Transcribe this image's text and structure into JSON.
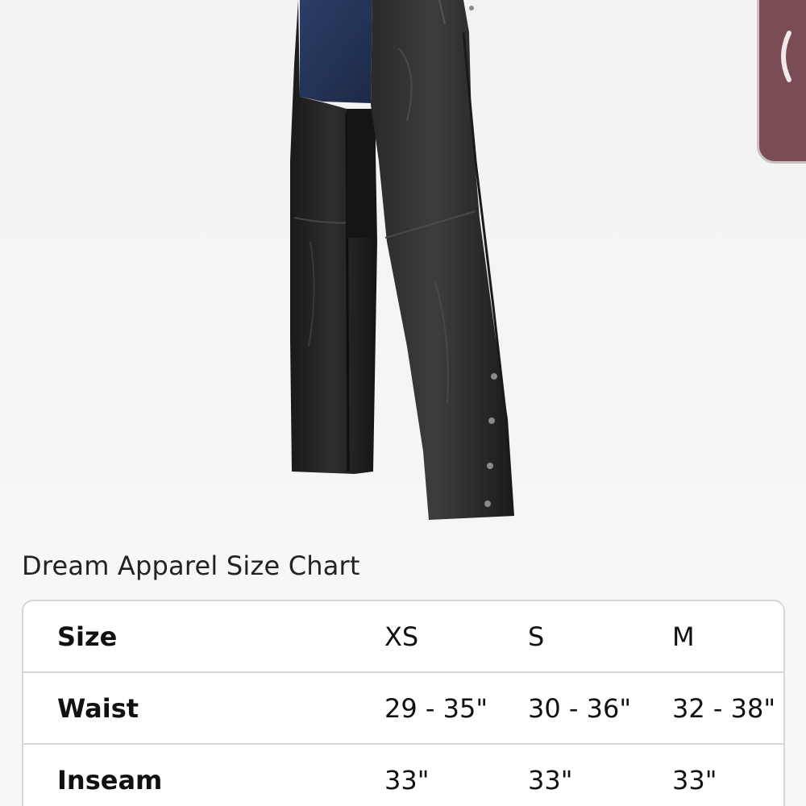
{
  "side_tab": {
    "icon": "chevron-left-icon",
    "color": "#7a4d55"
  },
  "product": {
    "image": "black-leather-chaps-photo"
  },
  "size_chart": {
    "title": "Dream Apparel Size Chart",
    "rows": [
      {
        "label": "Size",
        "values": [
          "XS",
          "S",
          "M"
        ]
      },
      {
        "label": "Waist",
        "values": [
          "29 - 35\"",
          "30 - 36\"",
          "32 - 38\""
        ]
      },
      {
        "label": "Inseam",
        "values": [
          "33\"",
          "33\"",
          "33\""
        ]
      }
    ]
  }
}
